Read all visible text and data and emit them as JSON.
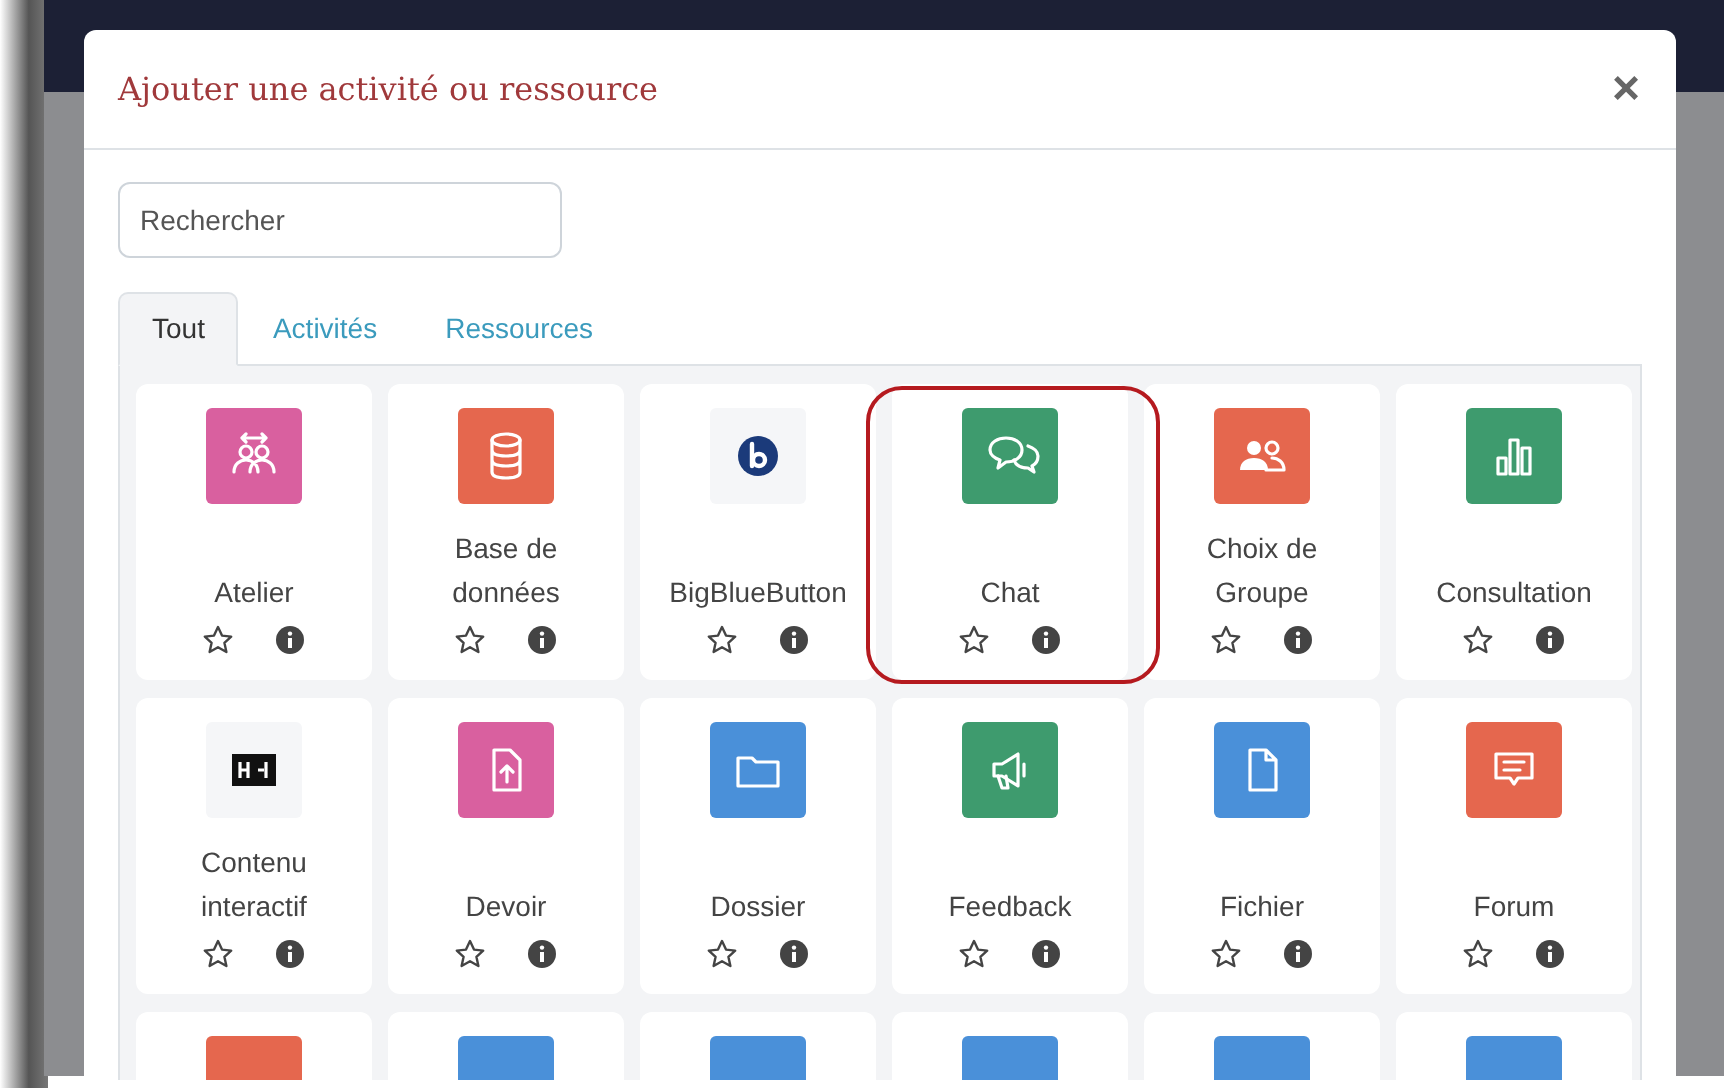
{
  "dialog": {
    "title": "Ajouter une activité ou ressource",
    "close": "×"
  },
  "search": {
    "placeholder": "Rechercher"
  },
  "tabs": [
    {
      "label": "Tout",
      "selected": true
    },
    {
      "label": "Activités",
      "selected": false
    },
    {
      "label": "Ressources",
      "selected": false
    }
  ],
  "modules": [
    {
      "name": "Atelier",
      "kind": "workshop",
      "color": "#d9609f",
      "starred": false,
      "highlighted": false
    },
    {
      "name": "Base de données",
      "kind": "database",
      "color": "#e5674e",
      "starred": false,
      "highlighted": false
    },
    {
      "name": "BigBlueButton",
      "kind": "bbb",
      "color": "#f5f6f8",
      "starred": false,
      "highlighted": false
    },
    {
      "name": "Chat",
      "kind": "chat",
      "color": "#3e9b6e",
      "starred": false,
      "highlighted": true
    },
    {
      "name": "Choix de Groupe",
      "kind": "group",
      "color": "#e5674e",
      "starred": false,
      "highlighted": false
    },
    {
      "name": "Consultation",
      "kind": "poll",
      "color": "#3e9b6e",
      "starred": false,
      "highlighted": false
    },
    {
      "name": "Contenu interactif",
      "kind": "h5p",
      "color": "#f5f6f8",
      "starred": false,
      "highlighted": false
    },
    {
      "name": "Devoir",
      "kind": "assign",
      "color": "#d9609f",
      "starred": false,
      "highlighted": false
    },
    {
      "name": "Dossier",
      "kind": "folder",
      "color": "#4a90d9",
      "starred": false,
      "highlighted": false
    },
    {
      "name": "Feedback",
      "kind": "feedback",
      "color": "#3e9b6e",
      "starred": false,
      "highlighted": false
    },
    {
      "name": "Fichier",
      "kind": "file",
      "color": "#4a90d9",
      "starred": false,
      "highlighted": false
    },
    {
      "name": "Forum",
      "kind": "forum",
      "color": "#e5674e",
      "starred": false,
      "highlighted": false
    },
    {
      "kind": "blank",
      "color": "#e5674e",
      "highlighted": false
    },
    {
      "kind": "blank",
      "color": "#4a90d9",
      "highlighted": false
    },
    {
      "kind": "blank",
      "color": "#4a90d9",
      "highlighted": false
    },
    {
      "kind": "blank",
      "color": "#4a90d9",
      "highlighted": false
    },
    {
      "kind": "blank",
      "color": "#4a90d9",
      "highlighted": false
    },
    {
      "kind": "blank",
      "color": "#4a90d9",
      "highlighted": false
    }
  ]
}
